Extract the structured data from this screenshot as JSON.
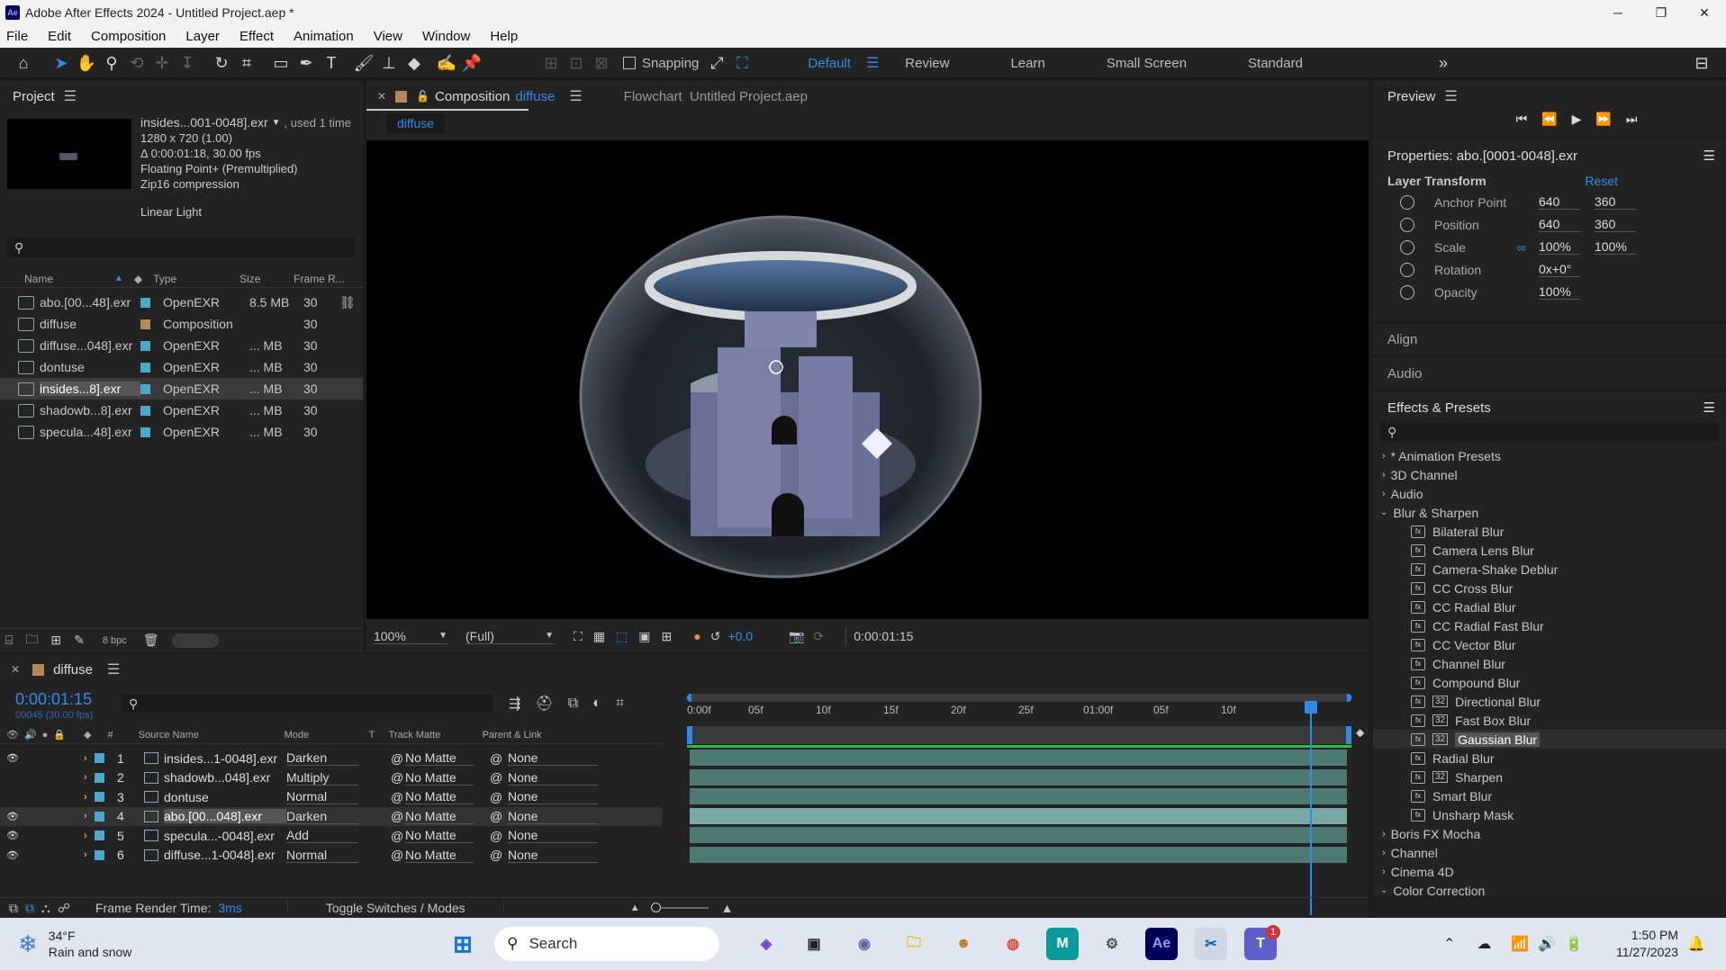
{
  "window": {
    "title": "Adobe After Effects 2024 - Untitled Project.aep *",
    "app_badge": "Ae"
  },
  "menu": [
    "File",
    "Edit",
    "Composition",
    "Layer",
    "Effect",
    "Animation",
    "View",
    "Window",
    "Help"
  ],
  "toolbar": {
    "snapping_label": "Snapping",
    "workspaces": [
      "Default",
      "Review",
      "Learn",
      "Small Screen",
      "Standard"
    ],
    "active_workspace": "Default"
  },
  "project": {
    "title": "Project",
    "selected_name": "insides...001-0048].exr",
    "used": ", used 1 time",
    "info": [
      "1280 x 720 (1.00)",
      "Δ 0:00:01:18, 30.00 fps",
      "Floating Point+ (Premultiplied)",
      "Zip16 compression"
    ],
    "color_space": "Linear Light",
    "columns": [
      "Name",
      "Type",
      "Size",
      "Frame R..."
    ],
    "items": [
      {
        "name": "abo.[00...48].exr",
        "color": "#4aa8c8",
        "type": "OpenEXR",
        "size": "8.5 MB",
        "fps": "30"
      },
      {
        "name": "diffuse",
        "color": "#b28a5a",
        "type": "Composition",
        "size": "",
        "fps": "30"
      },
      {
        "name": "diffuse...048].exr",
        "color": "#4aa8c8",
        "type": "OpenEXR",
        "size": "... MB",
        "fps": "30"
      },
      {
        "name": "dontuse",
        "color": "#4aa8c8",
        "type": "OpenEXR",
        "size": "... MB",
        "fps": "30"
      },
      {
        "name": "insides...8].exr",
        "color": "#4aa8c8",
        "type": "OpenEXR",
        "size": "... MB",
        "fps": "30"
      },
      {
        "name": "shadowb...8].exr",
        "color": "#4aa8c8",
        "type": "OpenEXR",
        "size": "... MB",
        "fps": "30"
      },
      {
        "name": "specula...48].exr",
        "color": "#4aa8c8",
        "type": "OpenEXR",
        "size": "... MB",
        "fps": "30"
      }
    ],
    "bpc": "8 bpc"
  },
  "composition": {
    "tab_prefix": "Composition",
    "tab_name": "diffuse",
    "flowchart": "Flowchart  Untitled Project.aep",
    "subtab": "diffuse",
    "zoom": "100%",
    "resolution": "(Full)",
    "exposure": "+0.0",
    "timecode": "0:00:01:15"
  },
  "preview": {
    "title": "Preview"
  },
  "properties": {
    "title": "Properties: abo.[0001-0048].exr",
    "section": "Layer Transform",
    "reset": "Reset",
    "rows": [
      {
        "label": "Anchor Point",
        "v1": "640",
        "v2": "360"
      },
      {
        "label": "Position",
        "v1": "640",
        "v2": "360"
      },
      {
        "label": "Scale",
        "v1": "100%",
        "v2": "100%"
      },
      {
        "label": "Rotation",
        "v1": "0x+0°",
        "v2": ""
      },
      {
        "label": "Opacity",
        "v1": "100%",
        "v2": ""
      }
    ],
    "align": "Align",
    "audio": "Audio"
  },
  "effects": {
    "title": "Effects & Presets",
    "categories_top": [
      "* Animation Presets",
      "3D Channel",
      "Audio"
    ],
    "open_category": "Blur & Sharpen",
    "items": [
      "Bilateral Blur",
      "Camera Lens Blur",
      "Camera-Shake Deblur",
      "CC Cross Blur",
      "CC Radial Blur",
      "CC Radial Fast Blur",
      "CC Vector Blur",
      "Channel Blur",
      "Compound Blur",
      "Directional Blur",
      "Fast Box Blur",
      "Gaussian Blur",
      "Radial Blur",
      "Sharpen",
      "Smart Blur",
      "Unsharp Mask"
    ],
    "selected": "Gaussian Blur",
    "categories_bottom": [
      "Boris FX Mocha",
      "Channel",
      "Cinema 4D",
      "Color Correction"
    ]
  },
  "timeline": {
    "comp_name": "diffuse",
    "timecode": "0:00:01:15",
    "frames": "00045 (30.00 fps)",
    "columns": {
      "source": "Source Name",
      "mode": "Mode",
      "t": "T",
      "matte": "Track Matte",
      "parent": "Parent & Link"
    },
    "ruler": [
      "0:00f",
      "05f",
      "10f",
      "15f",
      "20f",
      "25f",
      "01:00f",
      "05f",
      "10f"
    ],
    "playhead_fraction": 0.938,
    "layers": [
      {
        "num": "1",
        "name": "insides...1-0048].exr",
        "mode": "Darken",
        "matte": "No Matte",
        "parent": "None",
        "visible": true
      },
      {
        "num": "2",
        "name": "shadowb...048].exr",
        "mode": "Multiply",
        "matte": "No Matte",
        "parent": "None",
        "visible": false
      },
      {
        "num": "3",
        "name": "dontuse",
        "mode": "Normal",
        "matte": "No Matte",
        "parent": "None",
        "visible": false
      },
      {
        "num": "4",
        "name": "abo.[00...048].exr",
        "mode": "Darken",
        "matte": "No Matte",
        "parent": "None",
        "visible": true
      },
      {
        "num": "5",
        "name": "specula...-0048].exr",
        "mode": "Add",
        "matte": "No Matte",
        "parent": "None",
        "visible": true
      },
      {
        "num": "6",
        "name": "diffuse...1-0048].exr",
        "mode": "Normal",
        "matte": "No Matte",
        "parent": "None",
        "visible": true
      }
    ],
    "render_label": "Frame Render Time:",
    "render_value": "3ms",
    "toggle": "Toggle Switches / Modes"
  },
  "taskbar": {
    "weather_temp": "34°F",
    "weather_desc": "Rain and snow",
    "search": "Search",
    "time": "1:50 PM",
    "date": "11/27/2023",
    "notification_count": "1"
  }
}
